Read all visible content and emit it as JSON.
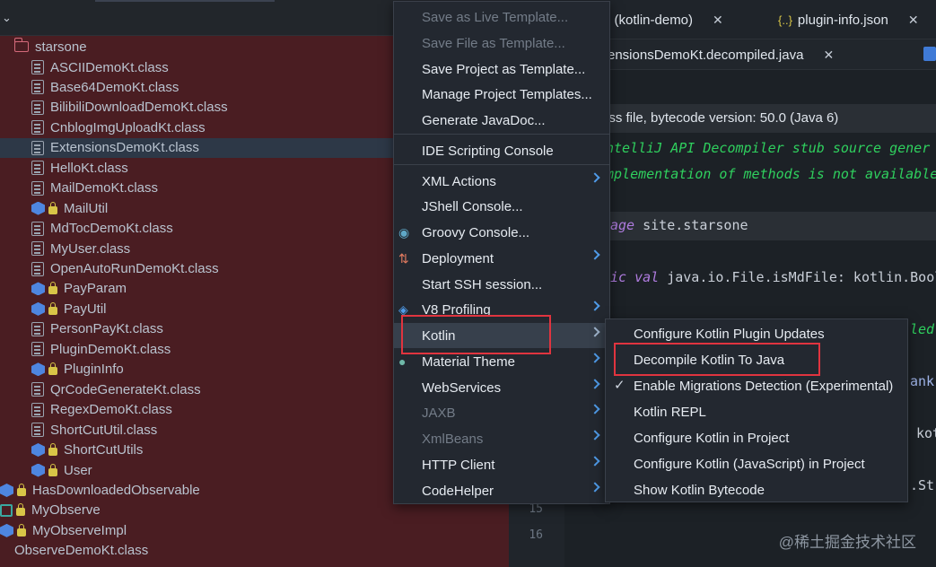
{
  "tree": {
    "root": "starsone",
    "items": [
      {
        "label": "ASCIIDemoKt.class",
        "kind": "class",
        "indent": 1
      },
      {
        "label": "Base64DemoKt.class",
        "kind": "class",
        "indent": 1
      },
      {
        "label": "BilibiliDownloadDemoKt.class",
        "kind": "class",
        "indent": 1
      },
      {
        "label": "CnblogImgUploadKt.class",
        "kind": "class",
        "indent": 1
      },
      {
        "label": "ExtensionsDemoKt.class",
        "kind": "class",
        "indent": 1,
        "selected": true
      },
      {
        "label": "HelloKt.class",
        "kind": "class",
        "indent": 1
      },
      {
        "label": "MailDemoKt.class",
        "kind": "class",
        "indent": 1
      },
      {
        "label": "MailUtil",
        "kind": "kotlin",
        "indent": 1
      },
      {
        "label": "MdTocDemoKt.class",
        "kind": "class",
        "indent": 1
      },
      {
        "label": "MyUser.class",
        "kind": "class",
        "indent": 1
      },
      {
        "label": "OpenAutoRunDemoKt.class",
        "kind": "class",
        "indent": 1
      },
      {
        "label": "PayParam",
        "kind": "kotlin",
        "indent": 1
      },
      {
        "label": "PayUtil",
        "kind": "kotlin",
        "indent": 1
      },
      {
        "label": "PersonPayKt.class",
        "kind": "class",
        "indent": 1
      },
      {
        "label": "PluginDemoKt.class",
        "kind": "class",
        "indent": 1
      },
      {
        "label": "PluginInfo",
        "kind": "kotlin",
        "indent": 1
      },
      {
        "label": "QrCodeGenerateKt.class",
        "kind": "class",
        "indent": 1
      },
      {
        "label": "RegexDemoKt.class",
        "kind": "class",
        "indent": 1
      },
      {
        "label": "ShortCutUtil.class",
        "kind": "class",
        "indent": 1
      },
      {
        "label": "ShortCutUtils",
        "kind": "kotlin",
        "indent": 1
      },
      {
        "label": "User",
        "kind": "kotlin",
        "indent": 1
      },
      {
        "label": "HasDownloadedObservable",
        "kind": "kotlin",
        "indent": 0
      },
      {
        "label": "MyObserve",
        "kind": "struct",
        "indent": 0
      },
      {
        "label": "MyObserveImpl",
        "kind": "kotlin",
        "indent": 0
      },
      {
        "label": "ObserveDemoKt.class",
        "kind": "plain",
        "indent": 0
      }
    ]
  },
  "editor": {
    "tabs": [
      {
        "label": "l (kotlin-demo)",
        "close": "✕"
      },
      {
        "label": "plugin-info.json",
        "icon": "{..}",
        "close": "✕"
      }
    ],
    "tab2": {
      "label": "ensionsDemoKt.decompiled.java",
      "close": "✕"
    },
    "info_text": "ass file, bytecode version: 50.0 (Java 6)",
    "comment1": "ntelliJ API Decompiler stub source gener",
    "comment2": "mplementation of methods is not available",
    "package_kw": "age",
    "package_name": " site.starsone",
    "decl_kw1": "ic",
    "decl_kw2": " val",
    "decl_rest": " java.io.File.isMdFile: kotlin.Bool",
    "frag1": "led",
    "frag2": "ank",
    "frag3": "kot",
    "frag4": ".Str",
    "line_numbers": [
      "15",
      "16"
    ]
  },
  "main_menu": [
    {
      "label": "Save as Live Template...",
      "disabled": true
    },
    {
      "label": "Save File as Template...",
      "disabled": true
    },
    {
      "label": "Save Project as Template..."
    },
    {
      "label": "Manage Project Templates..."
    },
    {
      "label": "Generate JavaDoc..."
    },
    {
      "label": "IDE Scripting Console",
      "sep_before": true
    },
    {
      "label": "XML Actions",
      "submenu": true,
      "sep_before": true
    },
    {
      "label": "JShell Console..."
    },
    {
      "label": "Groovy Console...",
      "icon": "groovy-icon"
    },
    {
      "label": "Deployment",
      "submenu": true,
      "icon": "deployment-icon"
    },
    {
      "label": "Start SSH session..."
    },
    {
      "label": "V8 Profiling",
      "submenu": true,
      "icon": "v8-icon"
    },
    {
      "label": "Kotlin",
      "submenu": true,
      "hover": true
    },
    {
      "label": "Material Theme",
      "submenu": true,
      "icon": "material-theme-icon"
    },
    {
      "label": "WebServices",
      "submenu": true
    },
    {
      "label": "JAXB",
      "submenu": true,
      "disabled": true
    },
    {
      "label": "XmlBeans",
      "submenu": true,
      "disabled": true
    },
    {
      "label": "HTTP Client",
      "submenu": true
    },
    {
      "label": "CodeHelper",
      "submenu": true
    }
  ],
  "kotlin_menu": [
    {
      "label": "Configure Kotlin Plugin Updates"
    },
    {
      "label": "Decompile Kotlin To Java",
      "highlight": true
    },
    {
      "label": "Enable Migrations Detection (Experimental)",
      "checked": true
    },
    {
      "label": "Kotlin REPL"
    },
    {
      "label": "Configure Kotlin in Project"
    },
    {
      "label": "Configure Kotlin (JavaScript) in Project"
    },
    {
      "label": "Show Kotlin Bytecode"
    }
  ],
  "check_mark": "✓",
  "watermark": "@稀土掘金技术社区",
  "colors": {
    "highlight_box": "#e0343f",
    "tree_bg": "#4a1d22",
    "menu_bg": "#232830",
    "arrow": "#4f9be8"
  }
}
